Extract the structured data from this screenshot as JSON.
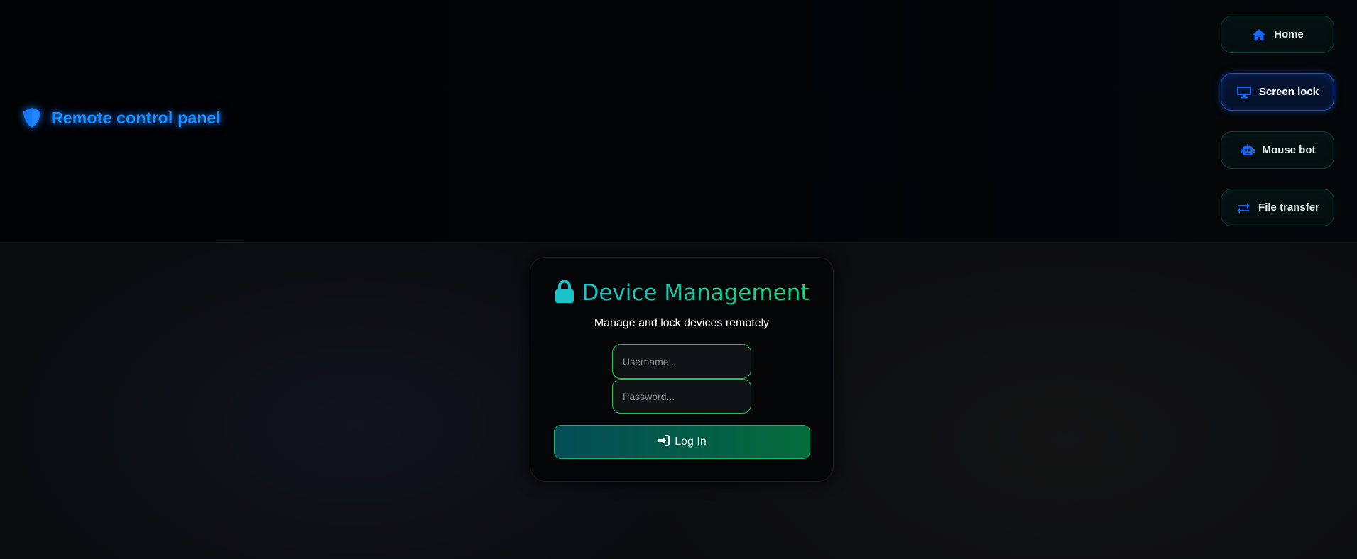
{
  "brand": {
    "title": "Remote control panel",
    "icon": "shield-icon"
  },
  "nav": {
    "items": [
      {
        "label": "Home",
        "icon": "home-icon",
        "active": false
      },
      {
        "label": "Screen lock",
        "icon": "monitor-icon",
        "active": true
      },
      {
        "label": "Mouse bot",
        "icon": "robot-icon",
        "active": false
      },
      {
        "label": "File transfer",
        "icon": "arrows-exchange-icon",
        "active": false
      }
    ]
  },
  "card": {
    "title": "Device Management",
    "title_icon": "lock-icon",
    "subtitle": "Manage and lock devices remotely",
    "username_placeholder": "Username...",
    "username_value": "",
    "password_placeholder": "Password...",
    "password_value": "",
    "login_label": "Log In",
    "login_icon": "sign-in-icon"
  },
  "colors": {
    "accent_blue": "#1e8fff",
    "accent_teal": "#19c2c6",
    "accent_green": "#22c35c",
    "nav_icon_blue": "#1565ff"
  }
}
